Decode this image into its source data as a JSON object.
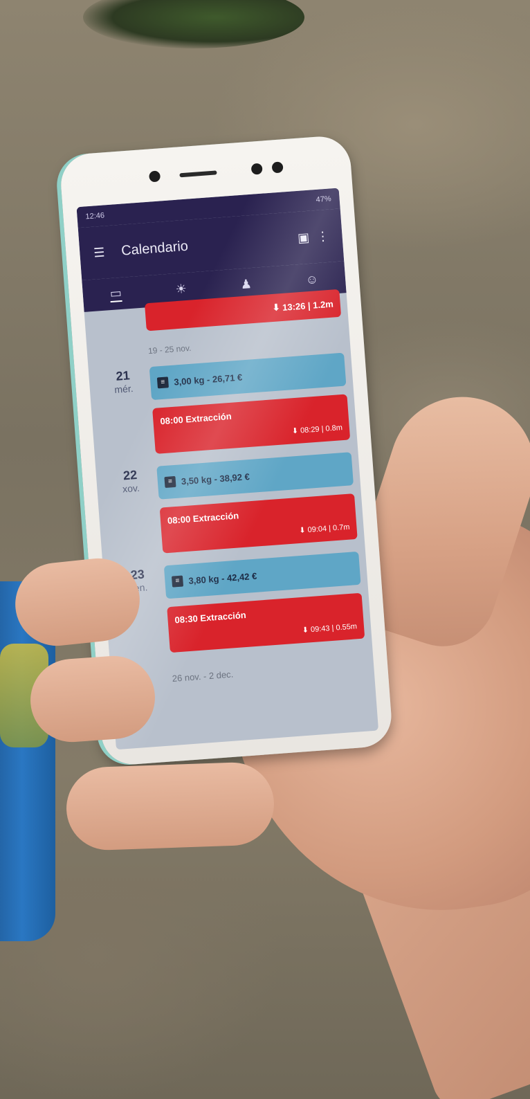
{
  "status_bar": {
    "time": "12:46",
    "battery": "47%"
  },
  "app_bar": {
    "title": "Calendario",
    "menu_icon": "menu-icon",
    "calendar_icon": "calendar-today-icon",
    "more_icon": "more-vert-icon"
  },
  "tabs": [
    {
      "name": "calendar-tab",
      "icon": "calendar-icon",
      "glyph": "▭"
    },
    {
      "name": "weather-tab",
      "icon": "sun-icon",
      "glyph": "☀"
    },
    {
      "name": "alerts-tab",
      "icon": "bell-icon",
      "glyph": "🔔"
    },
    {
      "name": "profile-tab",
      "icon": "person-icon",
      "glyph": "👤"
    }
  ],
  "top_event": {
    "right": "13:26 | 1.2m"
  },
  "week_header": "19 - 25 nov.",
  "days": [
    {
      "num": "21",
      "wd": "mér.",
      "blue": "3,00 kg - 26,71 €",
      "red_title": "08:00 Extracción",
      "red_right": "08:29 | 0.8m"
    },
    {
      "num": "22",
      "wd": "xov.",
      "blue": "3,50 kg - 38,92 €",
      "red_title": "08:00 Extracción",
      "red_right": "09:04 | 0.7m"
    },
    {
      "num": "23",
      "wd": "ven.",
      "blue": "3,80 kg - 42,42 €",
      "red_title": "08:30 Extracción",
      "red_right": "09:43 | 0.55m"
    }
  ],
  "next_week": "26 nov. - 2 dec."
}
